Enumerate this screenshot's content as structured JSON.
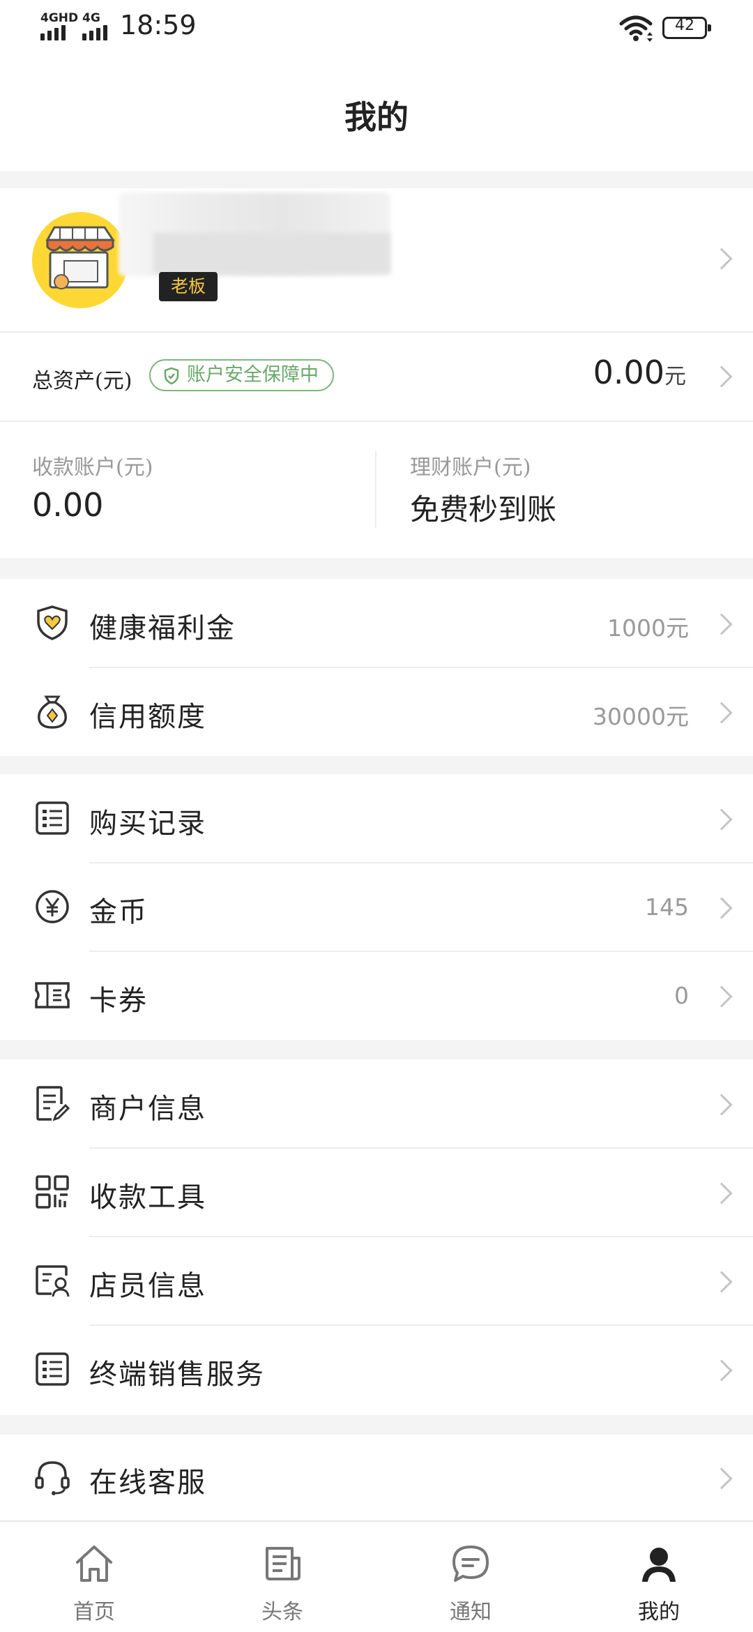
{
  "status_bar": {
    "network1": "4GHD",
    "network2": "4G",
    "time": "18:59",
    "battery": "42"
  },
  "header": {
    "title": "我的"
  },
  "profile": {
    "role_badge": "老板"
  },
  "assets": {
    "label": "总资产(元)",
    "security_badge": "账户安全保障中",
    "value": "0.00",
    "unit": "元"
  },
  "accounts": {
    "receiving": {
      "label": "收款账户(元)",
      "value": "0.00"
    },
    "finance": {
      "label": "理财账户(元)",
      "value": "免费秒到账"
    }
  },
  "menu_group1": [
    {
      "icon": "shield-heart-icon",
      "label": "健康福利金",
      "value": "1000元"
    },
    {
      "icon": "money-bag-icon",
      "label": "信用额度",
      "value": "30000元"
    }
  ],
  "menu_group2": [
    {
      "icon": "list-icon",
      "label": "购买记录",
      "value": ""
    },
    {
      "icon": "yen-coin-icon",
      "label": "金币",
      "value": "145"
    },
    {
      "icon": "ticket-icon",
      "label": "卡券",
      "value": "0"
    }
  ],
  "menu_group3": [
    {
      "icon": "document-edit-icon",
      "label": "商户信息",
      "value": ""
    },
    {
      "icon": "qr-code-icon",
      "label": "收款工具",
      "value": ""
    },
    {
      "icon": "staff-card-icon",
      "label": "店员信息",
      "value": ""
    },
    {
      "icon": "list-icon",
      "label": "终端销售服务",
      "value": ""
    }
  ],
  "menu_group4": [
    {
      "icon": "headset-icon",
      "label": "在线客服",
      "value": ""
    }
  ],
  "bottom_nav": [
    {
      "icon": "home-icon",
      "label": "首页",
      "active": false
    },
    {
      "icon": "news-icon",
      "label": "头条",
      "active": false
    },
    {
      "icon": "chat-icon",
      "label": "通知",
      "active": false
    },
    {
      "icon": "person-icon",
      "label": "我的",
      "active": true
    }
  ]
}
